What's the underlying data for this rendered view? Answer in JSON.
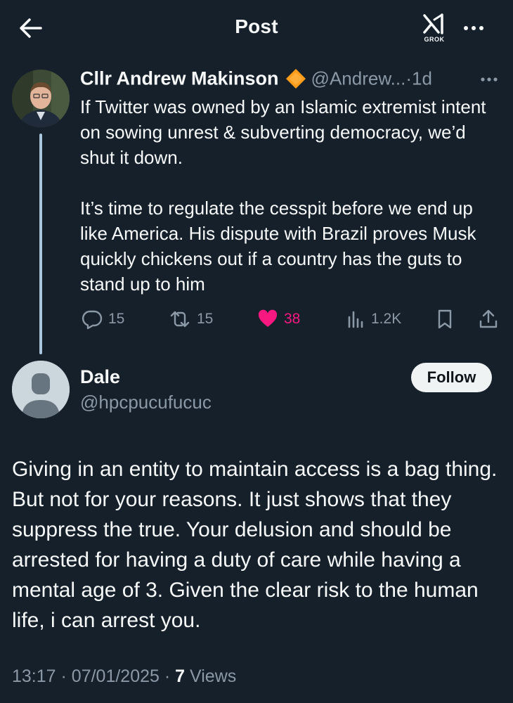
{
  "header": {
    "title": "Post",
    "grok_label": "GROK"
  },
  "parent_tweet": {
    "author_name": "Cllr Andrew Makinson",
    "author_handle": "@Andrew...",
    "separator": "·",
    "time": "1d",
    "paragraphs": [
      "If Twitter was owned by an Islamic extremist intent on sowing unrest & subverting democracy, we’d shut it down.",
      "It’s time to regulate the cesspit before we end up like America. His dispute with Brazil proves Musk quickly chickens out if a country has the guts to stand up to him"
    ],
    "replies": "15",
    "reposts": "15",
    "likes": "38",
    "views": "1.2K"
  },
  "reply": {
    "author_name": "Dale",
    "author_handle": "@hpcpucufucuc",
    "follow_label": "Follow",
    "text": "Giving in an entity to maintain access is a bag thing. But not for your reasons. It just shows that they suppress the true. Your delusion and should be arrested for having a duty of care while having a mental age of 3. Given the clear risk to the human life, i can arrest you.",
    "time": "13:17",
    "dot": "·",
    "date": "07/01/2025",
    "views_count": "7",
    "views_label": "Views"
  },
  "colors": {
    "background": "#15202b",
    "text": "#f7f9f9",
    "muted": "#8b98a5",
    "like": "#f91880",
    "thread_line": "#a9c6dd",
    "badge": "#ff9c1a"
  },
  "icons": [
    "back-arrow-icon",
    "grok-icon",
    "more-icon",
    "verified-badge-icon",
    "reply-icon",
    "repost-icon",
    "heart-icon",
    "views-icon",
    "bookmark-icon",
    "share-icon",
    "default-avatar-icon"
  ]
}
